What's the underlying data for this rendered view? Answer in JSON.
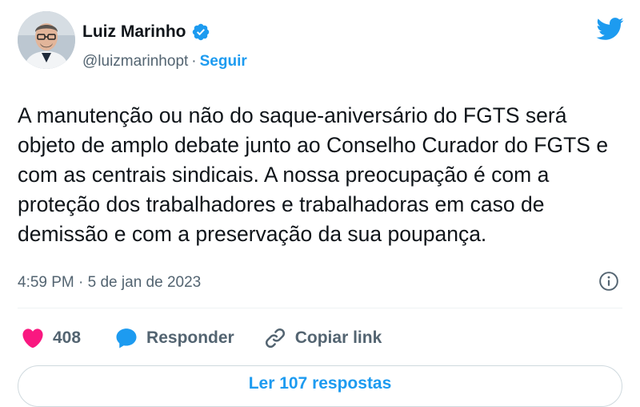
{
  "author": {
    "name": "Luiz Marinho",
    "handle": "@luizmarinhopt",
    "separator": "·",
    "follow_label": "Seguir"
  },
  "tweet": {
    "text": "A manutenção ou não do saque-aniversário do FGTS será objeto de amplo debate junto ao Conselho Curador do FGTS e com as centrais sindicais. A nossa preocupação é com a proteção dos trabalhadores e trabalhadoras em caso de demissão e com a preservação da sua poupança.",
    "timestamp": "4:59 PM · 5 de jan de 2023"
  },
  "actions": {
    "like_count": "408",
    "reply_label": "Responder",
    "copy_link_label": "Copiar link"
  },
  "replies_button": {
    "label": "Ler 107 respostas"
  },
  "icons": {
    "verified": "verified-badge-icon",
    "brand": "twitter-bird-icon",
    "info": "info-icon",
    "like": "heart-icon",
    "reply": "speech-bubble-icon",
    "copy_link": "link-icon"
  },
  "colors": {
    "accent": "#1d9bf0",
    "like": "#f91880",
    "text": "#0f1419",
    "muted": "#536471"
  }
}
